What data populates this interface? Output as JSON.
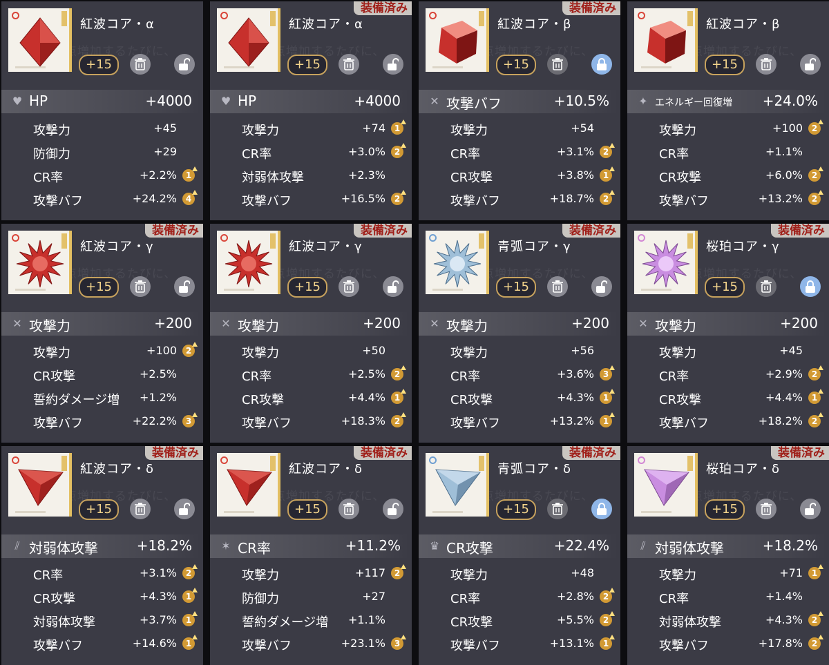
{
  "labels": {
    "equipped": "装備済み"
  },
  "bg_hint": "0点増加するたびに、",
  "colors": {
    "card_bg": "#3b3b45",
    "badge_red": "#a0201a",
    "gold": "#c7a25d",
    "red": "#c33a33",
    "blue": "#8fb2cf",
    "pink": "#c98de0",
    "locked": "#8fb6e8"
  },
  "cards": [
    {
      "name": "紅波コア・α",
      "color": "red",
      "shape": "diamond",
      "level": "+15",
      "locked": false,
      "equipped": false,
      "main": {
        "icon": "heart-icon",
        "name": "HP",
        "value": "+4000"
      },
      "subs": [
        {
          "name": "攻撃力",
          "value": "+45",
          "roll": ""
        },
        {
          "name": "防御力",
          "value": "+29",
          "roll": ""
        },
        {
          "name": "CR率",
          "value": "+2.2%",
          "roll": "1"
        },
        {
          "name": "攻撃バフ",
          "value": "+24.2%",
          "roll": "4"
        }
      ]
    },
    {
      "name": "紅波コア・α",
      "color": "red",
      "shape": "diamond",
      "level": "+15",
      "locked": false,
      "equipped": true,
      "main": {
        "icon": "heart-icon",
        "name": "HP",
        "value": "+4000"
      },
      "subs": [
        {
          "name": "攻撃力",
          "value": "+74",
          "roll": "1"
        },
        {
          "name": "CR率",
          "value": "+3.0%",
          "roll": "2"
        },
        {
          "name": "対弱体攻撃",
          "value": "+2.3%",
          "roll": ""
        },
        {
          "name": "攻撃バフ",
          "value": "+16.5%",
          "roll": "2"
        }
      ]
    },
    {
      "name": "紅波コア・β",
      "color": "red",
      "shape": "cube",
      "level": "+15",
      "locked": true,
      "equipped": true,
      "main": {
        "icon": "swords-icon",
        "name": "攻撃バフ",
        "value": "+10.5%"
      },
      "subs": [
        {
          "name": "攻撃力",
          "value": "+54",
          "roll": ""
        },
        {
          "name": "CR率",
          "value": "+3.1%",
          "roll": "2"
        },
        {
          "name": "CR攻撃",
          "value": "+3.8%",
          "roll": "1"
        },
        {
          "name": "攻撃バフ",
          "value": "+18.7%",
          "roll": "2"
        }
      ]
    },
    {
      "name": "紅波コア・β",
      "color": "red",
      "shape": "cube",
      "level": "+15",
      "locked": false,
      "equipped": false,
      "main": {
        "icon": "sparkle-icon",
        "name": "エネルギー回復増",
        "value": "+24.0%"
      },
      "subs": [
        {
          "name": "攻撃力",
          "value": "+100",
          "roll": "2"
        },
        {
          "name": "CR率",
          "value": "+1.1%",
          "roll": ""
        },
        {
          "name": "CR攻撃",
          "value": "+6.0%",
          "roll": "2"
        },
        {
          "name": "攻撃バフ",
          "value": "+13.2%",
          "roll": "2"
        }
      ]
    },
    {
      "name": "紅波コア・γ",
      "color": "red",
      "shape": "star",
      "level": "+15",
      "locked": false,
      "equipped": true,
      "main": {
        "icon": "swords-icon",
        "name": "攻撃力",
        "value": "+200"
      },
      "subs": [
        {
          "name": "攻撃力",
          "value": "+100",
          "roll": "2"
        },
        {
          "name": "CR攻撃",
          "value": "+2.5%",
          "roll": ""
        },
        {
          "name": "誓約ダメージ増",
          "value": "+1.2%",
          "roll": ""
        },
        {
          "name": "攻撃バフ",
          "value": "+22.2%",
          "roll": "3"
        }
      ]
    },
    {
      "name": "紅波コア・γ",
      "color": "red",
      "shape": "star",
      "level": "+15",
      "locked": false,
      "equipped": true,
      "main": {
        "icon": "swords-icon",
        "name": "攻撃力",
        "value": "+200"
      },
      "subs": [
        {
          "name": "攻撃力",
          "value": "+50",
          "roll": ""
        },
        {
          "name": "CR率",
          "value": "+2.5%",
          "roll": "2"
        },
        {
          "name": "CR攻撃",
          "value": "+4.4%",
          "roll": "1"
        },
        {
          "name": "攻撃バフ",
          "value": "+18.3%",
          "roll": "2"
        }
      ]
    },
    {
      "name": "青弧コア・γ",
      "color": "blue",
      "shape": "star",
      "level": "+15",
      "locked": false,
      "equipped": true,
      "main": {
        "icon": "swords-icon",
        "name": "攻撃力",
        "value": "+200"
      },
      "subs": [
        {
          "name": "攻撃力",
          "value": "+56",
          "roll": ""
        },
        {
          "name": "CR率",
          "value": "+3.6%",
          "roll": "3"
        },
        {
          "name": "CR攻撃",
          "value": "+4.3%",
          "roll": "1"
        },
        {
          "name": "攻撃バフ",
          "value": "+13.2%",
          "roll": "1"
        }
      ]
    },
    {
      "name": "桜珀コア・γ",
      "color": "pink",
      "shape": "star",
      "level": "+15",
      "locked": true,
      "equipped": true,
      "main": {
        "icon": "swords-icon",
        "name": "攻撃力",
        "value": "+200"
      },
      "subs": [
        {
          "name": "攻撃力",
          "value": "+45",
          "roll": ""
        },
        {
          "name": "CR率",
          "value": "+2.9%",
          "roll": "2"
        },
        {
          "name": "CR攻撃",
          "value": "+4.4%",
          "roll": "1"
        },
        {
          "name": "攻撃バフ",
          "value": "+18.2%",
          "roll": "2"
        }
      ]
    },
    {
      "name": "紅波コア・δ",
      "color": "red",
      "shape": "triangle",
      "level": "+15",
      "locked": false,
      "equipped": true,
      "main": {
        "icon": "claw-icon",
        "name": "対弱体攻撃",
        "value": "+18.2%"
      },
      "subs": [
        {
          "name": "CR率",
          "value": "+3.1%",
          "roll": "2"
        },
        {
          "name": "CR攻撃",
          "value": "+4.3%",
          "roll": "1"
        },
        {
          "name": "対弱体攻撃",
          "value": "+3.7%",
          "roll": "1"
        },
        {
          "name": "攻撃バフ",
          "value": "+14.6%",
          "roll": "1"
        }
      ]
    },
    {
      "name": "紅波コア・δ",
      "color": "red",
      "shape": "triangle",
      "level": "+15",
      "locked": false,
      "equipped": true,
      "main": {
        "icon": "burst-icon",
        "name": "CR率",
        "value": "+11.2%"
      },
      "subs": [
        {
          "name": "攻撃力",
          "value": "+117",
          "roll": "2"
        },
        {
          "name": "防御力",
          "value": "+27",
          "roll": ""
        },
        {
          "name": "誓約ダメージ増",
          "value": "+1.1%",
          "roll": ""
        },
        {
          "name": "攻撃バフ",
          "value": "+23.1%",
          "roll": "3"
        }
      ]
    },
    {
      "name": "青弧コア・δ",
      "color": "blue",
      "shape": "triangle",
      "level": "+15",
      "locked": true,
      "equipped": true,
      "main": {
        "icon": "crown-icon",
        "name": "CR攻撃",
        "value": "+22.4%"
      },
      "subs": [
        {
          "name": "攻撃力",
          "value": "+48",
          "roll": ""
        },
        {
          "name": "CR率",
          "value": "+2.8%",
          "roll": "2"
        },
        {
          "name": "CR攻撃",
          "value": "+5.5%",
          "roll": "2"
        },
        {
          "name": "攻撃バフ",
          "value": "+13.1%",
          "roll": "1"
        }
      ]
    },
    {
      "name": "桜珀コア・δ",
      "color": "pink",
      "shape": "triangle",
      "level": "+15",
      "locked": false,
      "equipped": true,
      "main": {
        "icon": "claw-icon",
        "name": "対弱体攻撃",
        "value": "+18.2%"
      },
      "subs": [
        {
          "name": "攻撃力",
          "value": "+71",
          "roll": "1"
        },
        {
          "name": "CR率",
          "value": "+1.4%",
          "roll": ""
        },
        {
          "name": "対弱体攻撃",
          "value": "+4.3%",
          "roll": "2"
        },
        {
          "name": "攻撃バフ",
          "value": "+17.8%",
          "roll": "2"
        }
      ]
    }
  ]
}
